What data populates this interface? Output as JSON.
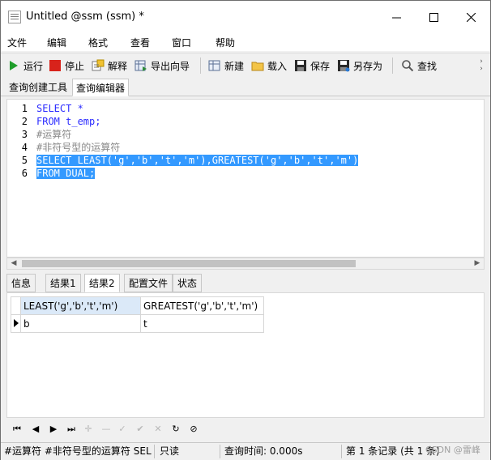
{
  "window": {
    "title": "Untitled @ssm (ssm) *"
  },
  "menu": [
    "文件",
    "编辑",
    "格式",
    "查看",
    "窗口",
    "帮助"
  ],
  "toolbar": {
    "run": "运行",
    "stop": "停止",
    "explain": "解释",
    "export_wizard": "导出向导",
    "new": "新建",
    "load": "载入",
    "save": "保存",
    "save_as": "另存为",
    "find": "查找"
  },
  "top_tabs": [
    "查询创建工具",
    "查询编辑器"
  ],
  "editor": {
    "line_numbers": [
      "1",
      "2",
      "3",
      "4",
      "5",
      "6"
    ],
    "lines": [
      "SELECT *",
      "FROM t_emp;",
      "#运算符",
      "#非符号型的运算符",
      "SELECT LEAST('g','b','t','m'),GREATEST('g','b','t','m')",
      "FROM DUAL;"
    ]
  },
  "result_tabs": [
    "信息",
    "结果1",
    "结果2",
    "配置文件",
    "状态"
  ],
  "grid": {
    "columns": [
      "LEAST('g','b','t','m')",
      "GREATEST('g','b','t','m')"
    ],
    "rows": [
      [
        "b",
        "t"
      ]
    ]
  },
  "status": {
    "query_text": "#运算符 #非符号型的运算符 SELECT",
    "mode": "只读",
    "query_time": "查询时间: 0.000s",
    "record": "第 1 条记录 (共 1 条)"
  },
  "watermark": "CSDN @雷峰",
  "colors": {
    "selection": "#3399ff",
    "keyword": "#2b2bff",
    "comment": "#888888",
    "header_highlight": "#dbe9f8"
  }
}
